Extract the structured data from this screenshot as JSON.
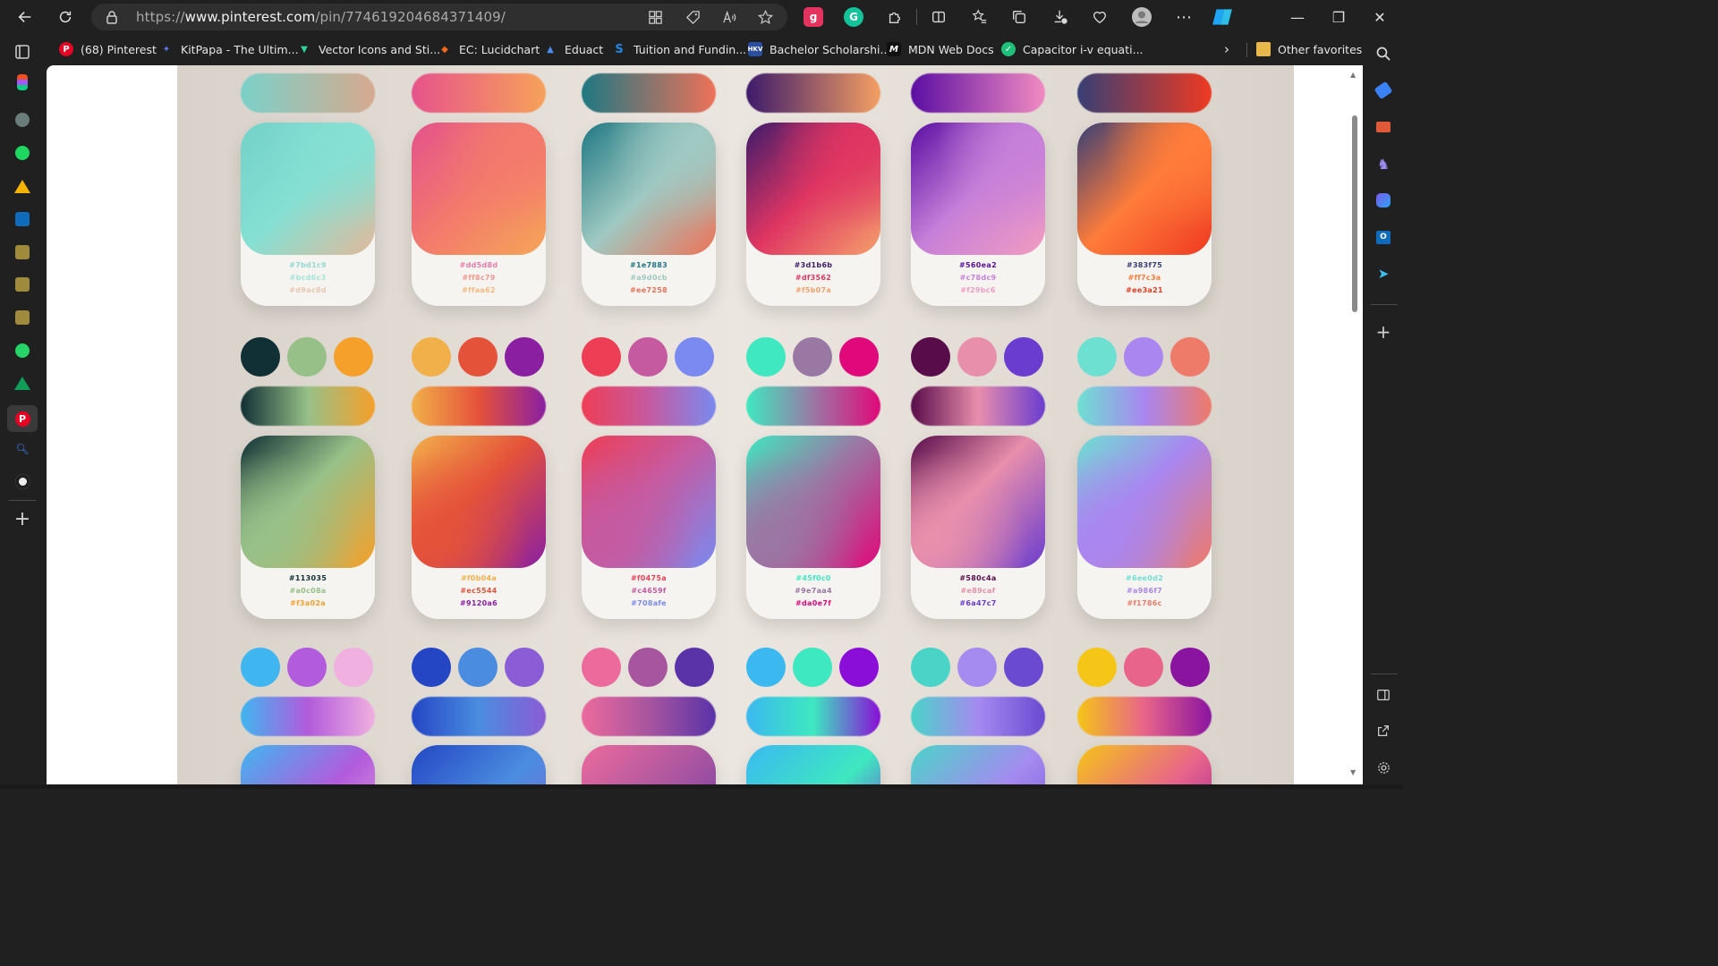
{
  "browser": {
    "url_prefix": "https://",
    "url_domain": "www.pinterest.com",
    "url_path": "/pin/774619204684371409/",
    "extensions": [
      {
        "name": "ghostery",
        "glyph": "g",
        "color": "#e5335f"
      },
      {
        "name": "grammarly",
        "glyph": "G",
        "color": "#15c39a"
      }
    ]
  },
  "favorites": [
    {
      "label": "(68) Pinterest",
      "icon": "pinterest-icon",
      "color": "#e60023",
      "glyph": "P"
    },
    {
      "label": "KitPapa - The Ultim...",
      "icon": "kitpapa-icon",
      "color": "#3b6bd6",
      "glyph": "K"
    },
    {
      "label": "Vector Icons and Sti...",
      "icon": "flaticon-icon",
      "color": "#2dd4a0",
      "glyph": "V"
    },
    {
      "label": "EC: Lucidchart",
      "icon": "lucidchart-icon",
      "color": "#f26b1d",
      "glyph": "L"
    },
    {
      "label": "Eduact",
      "icon": "eduact-icon",
      "color": "#3c78f0",
      "glyph": "E"
    },
    {
      "label": "Tuition and Fundin...",
      "icon": "tuition-icon",
      "color": "#1e88e5",
      "glyph": "S"
    },
    {
      "label": "Bachelor Scholarshi...",
      "icon": "hkv-icon",
      "color": "#2a4ea0",
      "glyph": "H"
    },
    {
      "label": "MDN Web Docs",
      "icon": "mdn-icon",
      "color": "#111111",
      "glyph": "M"
    },
    {
      "label": "Capacitor i-v equati...",
      "icon": "capacitor-icon",
      "color": "#1ec07a",
      "glyph": "C"
    }
  ],
  "other_favorites": "Other favorites",
  "palettes_row1": [
    {
      "from": "#7bd1c9",
      "to": "#d6a98e",
      "card": [
        "#72d1c9",
        "#86e0d3",
        "#e2b89a"
      ],
      "hex": [
        "#7bd1c9",
        "#bcd6c3",
        "#d9ac8d"
      ],
      "bold": false
    },
    {
      "from": "#e7538a",
      "to": "#f7a25a",
      "card": [
        "#e4528c",
        "#f37a6c",
        "#f5a657"
      ],
      "hex": [
        "#dd5d8d",
        "#ff8c79",
        "#ffaa62"
      ],
      "bold": false
    },
    {
      "from": "#1e7883",
      "to": "#ee7258",
      "card": [
        "#1e7883",
        "#9fc9c2",
        "#ee7258"
      ],
      "hex": [
        "#1e7883",
        "#a9d0cb",
        "#ee7258"
      ],
      "bold": true
    },
    {
      "from": "#3d1b6b",
      "to": "#f59f62",
      "card": [
        "#3d1b6b",
        "#df3562",
        "#f5a06c"
      ],
      "hex": [
        "#3d1b6b",
        "#df3562",
        "#f5b07a"
      ],
      "bold": true
    },
    {
      "from": "#5b0ea2",
      "to": "#f28bc2",
      "card": [
        "#5b0ea2",
        "#c780d9",
        "#f29cc0"
      ],
      "hex": [
        "#560ea2",
        "#c78dc9",
        "#f29bc6"
      ],
      "bold": true
    },
    {
      "from": "#383f75",
      "to": "#ee3a21",
      "card": [
        "#383f75",
        "#ff7c3a",
        "#ee3a21"
      ],
      "hex": [
        "#383f75",
        "#ff7c3a",
        "#ee3a21"
      ],
      "bold": true
    }
  ],
  "palettes_row2": [
    {
      "dots": [
        "#113035",
        "#97c088",
        "#f5a02a"
      ],
      "hex": [
        "#113035",
        "#a0c08a",
        "#f3a02a"
      ]
    },
    {
      "dots": [
        "#f2b04a",
        "#e5523a",
        "#8a1fa2"
      ],
      "hex": [
        "#f0b04a",
        "#ec5544",
        "#9120a6"
      ]
    },
    {
      "dots": [
        "#ee3e55",
        "#c65aa0",
        "#7a8af0"
      ],
      "hex": [
        "#f0475a",
        "#c4659f",
        "#708afe"
      ]
    },
    {
      "dots": [
        "#3fe8c0",
        "#9a78a4",
        "#e0087a"
      ],
      "hex": [
        "#45f0c0",
        "#9e7aa4",
        "#da0e7f"
      ]
    },
    {
      "dots": [
        "#580c4a",
        "#e88fac",
        "#6a3ccf"
      ],
      "hex": [
        "#580c4a",
        "#e89caf",
        "#6a47c7"
      ]
    },
    {
      "dots": [
        "#6ee0d2",
        "#a986f0",
        "#ee7a6a"
      ],
      "hex": [
        "#6ee0d2",
        "#a986f7",
        "#f1786c"
      ]
    }
  ],
  "palettes_row3": [
    {
      "dots": [
        "#3fb6f0",
        "#b25bdc",
        "#f0b0e0"
      ]
    },
    {
      "dots": [
        "#2446c4",
        "#4a8de0",
        "#8a5cd6"
      ]
    },
    {
      "dots": [
        "#ec6a9c",
        "#a855a0",
        "#5a33a8"
      ]
    },
    {
      "dots": [
        "#3bb8f0",
        "#3ee8c0",
        "#8a0ed8"
      ]
    },
    {
      "dots": [
        "#4ad4c8",
        "#a58af0",
        "#6a4ad0"
      ]
    },
    {
      "dots": [
        "#f5c518",
        "#e8648a",
        "#8a14a0"
      ]
    }
  ]
}
